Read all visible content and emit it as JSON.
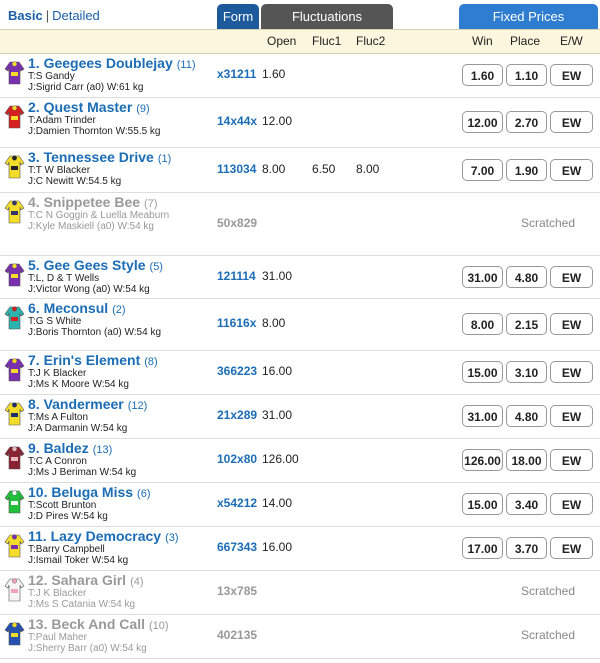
{
  "view_toggle": {
    "basic": "Basic",
    "separator": "|",
    "detailed": "Detailed"
  },
  "tabs": {
    "form": "Form",
    "fluctuations": "Fluctuations",
    "fixed_prices": "Fixed Prices"
  },
  "columns": {
    "open": "Open",
    "fluc1": "Fluc1",
    "fluc2": "Fluc2",
    "win": "Win",
    "place": "Place",
    "ew": "E/W"
  },
  "colors": {
    "accent": "#1b6db5",
    "form_tab": "#1d5a9b",
    "fluc_tab": "#555555",
    "fixed_tab": "#2f7dd0",
    "header_bg": "#fbf6dd"
  },
  "runners": [
    {
      "name": "1. Geegees Doublejay",
      "barrier": "(11)",
      "trainer": "T:S Gandy",
      "jockey": "J:Sigrid Carr (a0) W:61 kg",
      "form": "x31211",
      "open": "1.60",
      "fluc1": "",
      "fluc2": "",
      "win": "1.60",
      "place": "1.10",
      "ew": "EW",
      "scratched": false,
      "silk": "purple-yellow"
    },
    {
      "name": "2. Quest Master",
      "barrier": "(9)",
      "trainer": "T:Adam Trinder",
      "jockey": "J:Damien Thornton W:55.5 kg",
      "form": "14x44x",
      "open": "12.00",
      "fluc1": "",
      "fluc2": "",
      "win": "12.00",
      "place": "2.70",
      "ew": "EW",
      "scratched": false,
      "silk": "red-yellow"
    },
    {
      "name": "3. Tennessee Drive",
      "barrier": "(1)",
      "trainer": "T:T W Blacker",
      "jockey": "J:C Newitt W:54.5 kg",
      "form": "113034",
      "open": "8.00",
      "fluc1": "6.50",
      "fluc2": "8.00",
      "win": "7.00",
      "place": "1.90",
      "ew": "EW",
      "scratched": false,
      "silk": "yellow-black"
    },
    {
      "name": "4. Snippetee Bee",
      "barrier": "(7)",
      "trainer": "T:C N Goggin & Luella Meaburn",
      "jockey": "J:Kyle Maskiell (a0) W:54 kg",
      "form": "50x829",
      "open": "",
      "fluc1": "",
      "fluc2": "",
      "win": "",
      "place": "",
      "ew": "",
      "scratched": true,
      "scratched_label": "Scratched",
      "silk": "yellow-check"
    },
    {
      "name": "5. Gee Gees Style",
      "barrier": "(5)",
      "trainer": "T:L, D & T Wells",
      "jockey": "J:Victor Wong (a0) W:54 kg",
      "form": "121114",
      "open": "31.00",
      "fluc1": "",
      "fluc2": "",
      "win": "31.00",
      "place": "4.80",
      "ew": "EW",
      "scratched": false,
      "silk": "purple-yellow"
    },
    {
      "name": "6. Meconsul",
      "barrier": "(2)",
      "trainer": "T:G S White",
      "jockey": "J:Boris Thornton (a0) W:54 kg",
      "form": "11616x",
      "open": "8.00",
      "fluc1": "",
      "fluc2": "",
      "win": "8.00",
      "place": "2.15",
      "ew": "EW",
      "scratched": false,
      "silk": "teal-red"
    },
    {
      "name": "7. Erin's Element",
      "barrier": "(8)",
      "trainer": "T:J K Blacker",
      "jockey": "J:Ms K Moore W:54 kg",
      "form": "366223",
      "open": "16.00",
      "fluc1": "",
      "fluc2": "",
      "win": "15.00",
      "place": "3.10",
      "ew": "EW",
      "scratched": false,
      "silk": "purple-check"
    },
    {
      "name": "8. Vandermeer",
      "barrier": "(12)",
      "trainer": "T:Ms A Fulton",
      "jockey": "J:A Darmanin W:54 kg",
      "form": "21x289",
      "open": "31.00",
      "fluc1": "",
      "fluc2": "",
      "win": "31.00",
      "place": "4.80",
      "ew": "EW",
      "scratched": false,
      "silk": "yellow-navy"
    },
    {
      "name": "9. Baldez",
      "barrier": "(13)",
      "trainer": "T:C A Conron",
      "jockey": "J:Ms J Beriman W:54 kg",
      "form": "102x80",
      "open": "126.00",
      "fluc1": "",
      "fluc2": "",
      "win": "126.00",
      "place": "18.00",
      "ew": "EW",
      "scratched": false,
      "silk": "maroon-check"
    },
    {
      "name": "10. Beluga Miss",
      "barrier": "(6)",
      "trainer": "T:Scott Brunton",
      "jockey": "J:D Pires W:54 kg",
      "form": "x54212",
      "open": "14.00",
      "fluc1": "",
      "fluc2": "",
      "win": "15.00",
      "place": "3.40",
      "ew": "EW",
      "scratched": false,
      "silk": "green-white"
    },
    {
      "name": "11. Lazy Democracy",
      "barrier": "(3)",
      "trainer": "T:Barry Campbell",
      "jockey": "J:Ismail Toker W:54 kg",
      "form": "667343",
      "open": "16.00",
      "fluc1": "",
      "fluc2": "",
      "win": "17.00",
      "place": "3.70",
      "ew": "EW",
      "scratched": false,
      "silk": "yellow-purple"
    },
    {
      "name": "12. Sahara Girl",
      "barrier": "(4)",
      "trainer": "T:J K Blacker",
      "jockey": "J:Ms S Catania W:54 kg",
      "form": "13x785",
      "open": "",
      "fluc1": "",
      "fluc2": "",
      "win": "",
      "place": "",
      "ew": "",
      "scratched": true,
      "scratched_label": "Scratched",
      "silk": "white-pink"
    },
    {
      "name": "13. Beck And Call",
      "barrier": "(10)",
      "trainer": "T:Paul Maher",
      "jockey": "J:Sherry Barr (a0) W:54 kg",
      "form": "402135",
      "open": "",
      "fluc1": "",
      "fluc2": "",
      "win": "",
      "place": "",
      "ew": "",
      "scratched": true,
      "scratched_label": "Scratched",
      "silk": "blue-yellow"
    }
  ]
}
